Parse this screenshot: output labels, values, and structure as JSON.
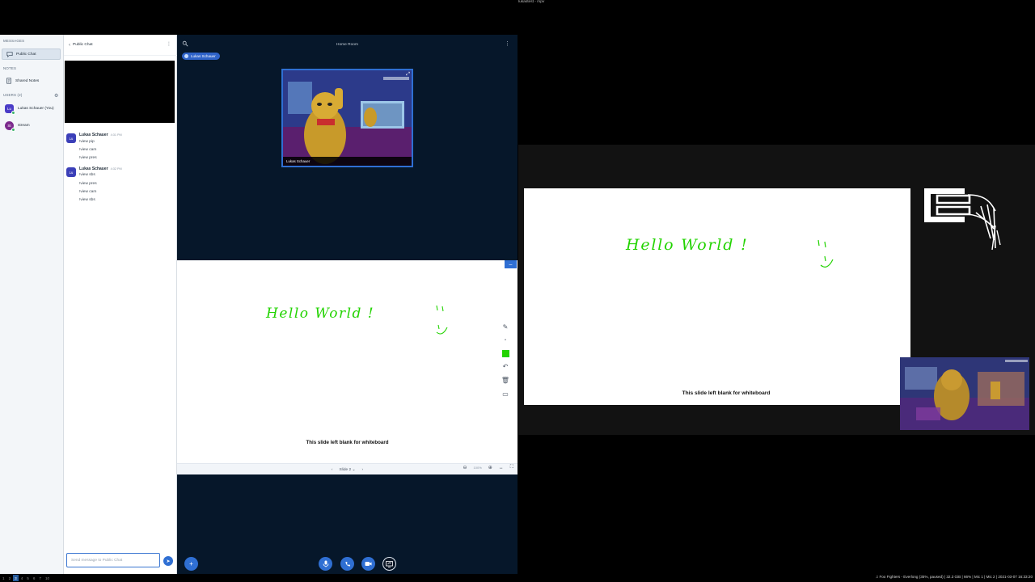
{
  "nav": {
    "messages_section": "MESSAGES",
    "public_chat": "Public Chat",
    "notes_section": "NOTES",
    "shared_notes": "Shared Notes",
    "users_section": "USERS (2)",
    "users": [
      {
        "initials": "Lu",
        "name": "Lukas Schauer (You)"
      },
      {
        "initials": "St",
        "name": "stream"
      }
    ]
  },
  "chat": {
    "title": "Public Chat",
    "messages": [
      {
        "initials": "Lu",
        "name": "Lukas Schauer",
        "time": "4:31 PM",
        "lines": [
          "!view pip",
          "!view cam",
          "!view pres"
        ]
      },
      {
        "initials": "Lu",
        "name": "Lukas Schauer",
        "time": "4:32 PM",
        "lines": [
          "!view sbs",
          "!view pres",
          "!view cam",
          "!view sbs"
        ]
      }
    ],
    "input_placeholder": "Send message to Public Chat"
  },
  "main": {
    "room_name": "Home Room",
    "talking_user": "Lukas Schauer",
    "webcam_caption": "Lukas Schauer",
    "whiteboard_text": "Hello World !",
    "slide_text": "This slide left blank for whiteboard",
    "slide_label": "Slide 2",
    "zoom": "100%"
  },
  "mpv": {
    "title": "lukastest - mpv",
    "slide_text": "This slide left blank for whiteboard",
    "whiteboard_text": "Hello World !"
  },
  "statusbar": {
    "workspaces": [
      "1",
      "2",
      "3",
      "4",
      "5",
      "6",
      "7",
      "10"
    ],
    "active_workspace": "3",
    "info": "♫ Foo Fighters - Everlong (35%, paused) | 32.3 GiB | 66% | Mic 1 | Mic 2 | 2021-03-07 16:33:20"
  },
  "colors": {
    "accent": "#2f6fd3",
    "main_bg": "#06172a",
    "whiteboard_pen": "#22d300"
  }
}
